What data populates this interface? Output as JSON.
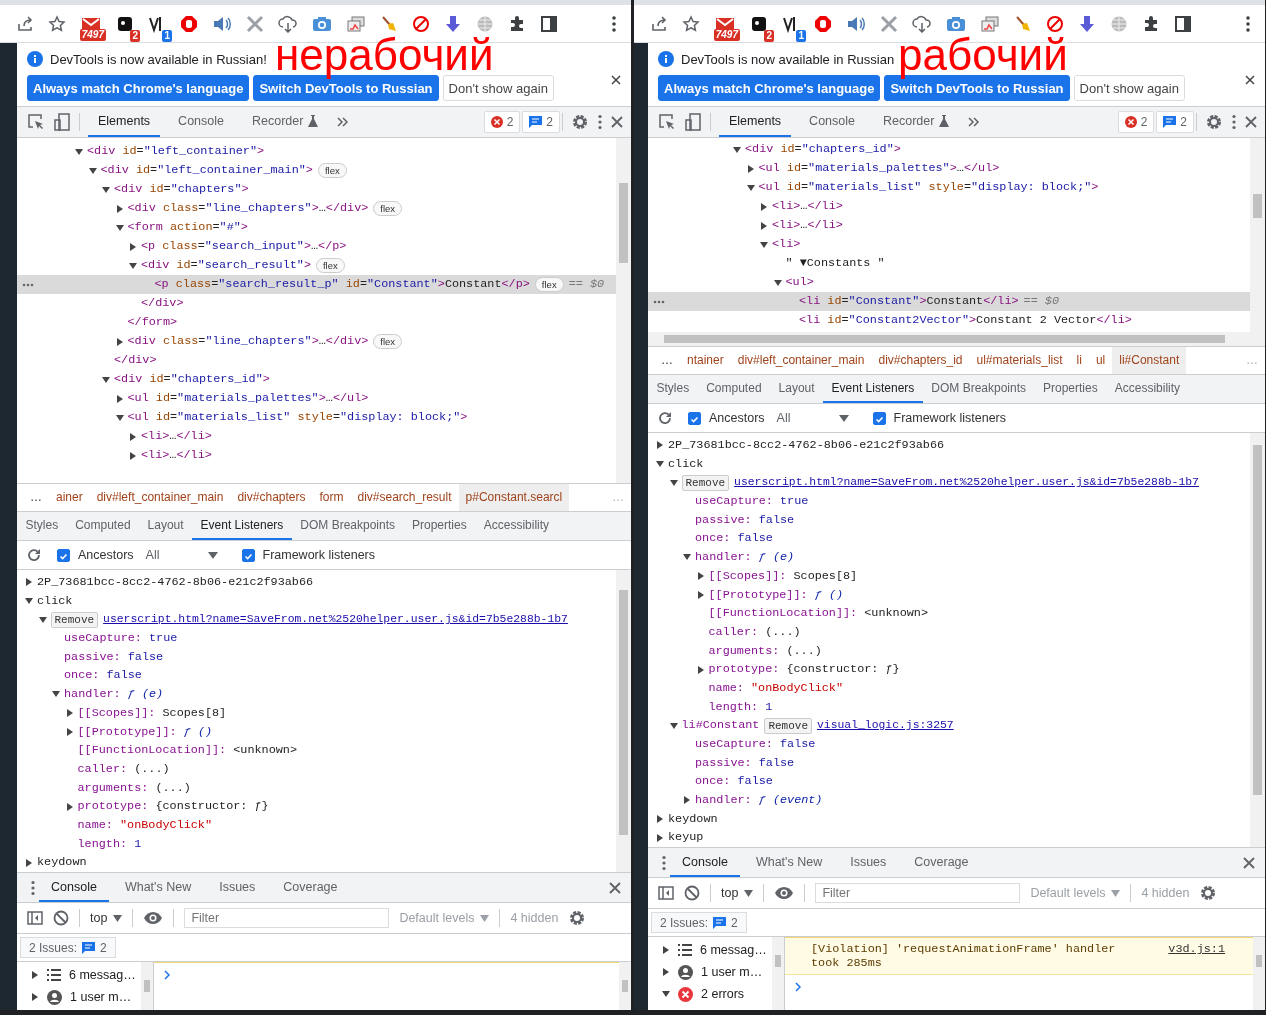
{
  "panels": [
    {
      "annotation": "нерабочий",
      "browser_icons": [
        {
          "kind": "share"
        },
        {
          "kind": "star"
        },
        {
          "kind": "mail",
          "badge": "7497"
        },
        {
          "kind": "square",
          "badge": "2"
        },
        {
          "kind": "vector",
          "badge": "1"
        },
        {
          "kind": "stop"
        },
        {
          "kind": "speaker"
        },
        {
          "kind": "crossed"
        },
        {
          "kind": "cloud"
        },
        {
          "kind": "camera"
        },
        {
          "kind": "windows"
        },
        {
          "kind": "broom"
        },
        {
          "kind": "blocked"
        },
        {
          "kind": "download"
        },
        {
          "kind": "globe"
        },
        {
          "kind": "puzzle"
        },
        {
          "kind": "sidebar"
        },
        {
          "kind": "kebab"
        }
      ],
      "infobar": {
        "message": "DevTools is now available in Russian!",
        "buttons": [
          {
            "label": "Always match Chrome's language",
            "kind": "primary"
          },
          {
            "label": "Switch DevTools to Russian",
            "kind": "primary"
          },
          {
            "label": "Don't show again",
            "kind": "secondary"
          }
        ]
      },
      "tabs": [
        {
          "label": "Elements",
          "selected": true,
          "experimental": false
        },
        {
          "label": "Console",
          "selected": false,
          "experimental": false
        },
        {
          "label": "Recorder",
          "selected": false,
          "experimental": true
        }
      ],
      "counters": {
        "errors": "2",
        "messages": "2"
      },
      "dom": [
        {
          "text": "<div id=\"left_container\">",
          "selected": false,
          "expanded": true,
          "children": [
            {
              "text": "<div id=\"left_container_main\">",
              "badge": "flex",
              "selected": false,
              "expanded": true,
              "children": [
                {
                  "text": "<div id=\"chapters\">",
                  "selected": false,
                  "expanded": true,
                  "close": "</div>",
                  "children": [
                    {
                      "text": "<div class=\"line_chapters\">…</div>",
                      "badge": "flex",
                      "selected": false,
                      "expanded": false
                    },
                    {
                      "text": "<form action=\"#\">",
                      "selected": false,
                      "expanded": true,
                      "close": "</form>",
                      "children": [
                        {
                          "text": "<p class=\"search_input\">…</p>",
                          "selected": false,
                          "expanded": false
                        },
                        {
                          "text": "<div id=\"search_result\">",
                          "badge": "flex",
                          "selected": false,
                          "expanded": true,
                          "close": "</div>",
                          "children": [
                            {
                              "text": "<p class=\"search_result_p\" id=\"Constant\">Constant</p>",
                              "badge": "flex",
                              "ref": "== $0",
                              "selected": true
                            }
                          ]
                        }
                      ]
                    },
                    {
                      "text": "<div class=\"line_chapters\">…</div>",
                      "badge": "flex",
                      "selected": false,
                      "expanded": false
                    }
                  ]
                },
                {
                  "text": "<div id=\"chapters_id\">",
                  "selected": false,
                  "expanded": true,
                  "children": [
                    {
                      "text": "<ul id=\"materials_palettes\">…</ul>",
                      "selected": false,
                      "expanded": false
                    },
                    {
                      "text": "<ul id=\"materials_list\" style=\"display: block;\">",
                      "selected": false,
                      "expanded": true,
                      "children": [
                        {
                          "text": "<li>…</li>",
                          "selected": false,
                          "expanded": false
                        },
                        {
                          "text": "<li>…</li>",
                          "selected": false,
                          "expanded": false
                        }
                      ]
                    }
                  ]
                }
              ]
            }
          ]
        }
      ],
      "breadcrumbs": {
        "overflow_left": "…",
        "items": [
          {
            "label": "ainer",
            "selected": false
          },
          {
            "label": "div#left_container_main",
            "selected": false
          },
          {
            "label": "div#chapters",
            "selected": false
          },
          {
            "label": "form",
            "selected": false
          },
          {
            "label": "div#search_result",
            "selected": false
          },
          {
            "label": "p#Constant.searcl",
            "selected": true
          }
        ],
        "overflow_right": "…"
      },
      "sidebar_tabs": [
        {
          "label": "Styles",
          "selected": false
        },
        {
          "label": "Computed",
          "selected": false
        },
        {
          "label": "Layout",
          "selected": false
        },
        {
          "label": "Event Listeners",
          "selected": true
        },
        {
          "label": "DOM Breakpoints",
          "selected": false
        },
        {
          "label": "Properties",
          "selected": false
        },
        {
          "label": "Accessibility",
          "selected": false
        }
      ],
      "listener_filter": {
        "ancestors": {
          "label": "Ancestors",
          "checked": true
        },
        "scope": "All",
        "framework": {
          "label": "Framework listeners",
          "checked": true
        }
      },
      "listeners": [
        {
          "kind": "event",
          "label": "2P_73681bcc-8cc2-4762-8b06-e21c2f93ab66",
          "expanded": false
        },
        {
          "kind": "event",
          "label": "click",
          "expanded": true,
          "children": [
            {
              "kind": "listener",
              "remove": "Remove",
              "source": "userscript.html?name=SaveFrom.net%2520helper.user.js&id=7b5e288b-1b7",
              "expanded": true,
              "children": [
                {
                  "kind": "keyword",
                  "key": "useCapture:",
                  "value": "true"
                },
                {
                  "kind": "keyword",
                  "key": "passive:",
                  "value": "false"
                },
                {
                  "kind": "keyword",
                  "key": "once:",
                  "value": "false"
                },
                {
                  "kind": "function",
                  "key": "handler:",
                  "value": "ƒ (e)",
                  "expanded": true,
                  "children": [
                    {
                      "kind": "object",
                      "key": "[[Scopes]]:",
                      "value": "Scopes[8]",
                      "expanded": false
                    },
                    {
                      "kind": "function",
                      "key": "[[Prototype]]:",
                      "value": "ƒ ()",
                      "expanded": false
                    },
                    {
                      "kind": "object",
                      "key": "[[FunctionLocation]]:",
                      "value": "<unknown>"
                    },
                    {
                      "kind": "object",
                      "key": "caller:",
                      "value": "(...)"
                    },
                    {
                      "kind": "object",
                      "key": "arguments:",
                      "value": "(...)"
                    },
                    {
                      "kind": "object",
                      "key": "prototype:",
                      "value": "{constructor: ƒ}",
                      "expanded": false
                    },
                    {
                      "kind": "string",
                      "key": "name:",
                      "value": "\"onBodyClick\""
                    },
                    {
                      "kind": "keyword",
                      "key": "length:",
                      "value": "1"
                    }
                  ]
                }
              ]
            }
          ]
        },
        {
          "kind": "event",
          "label": "keydown",
          "expanded": false
        }
      ],
      "drawer_tabs": [
        {
          "label": "Console",
          "selected": true
        },
        {
          "label": "What's New",
          "selected": false
        },
        {
          "label": "Issues",
          "selected": false
        },
        {
          "label": "Coverage",
          "selected": false
        }
      ],
      "console_toolbar": {
        "context": "top",
        "filter_placeholder": "Filter",
        "levels": "Default levels",
        "hidden": "4 hidden"
      },
      "issues": {
        "label": "2 Issues:",
        "count": "2"
      },
      "console_sidebar": [
        {
          "kind": "messages",
          "label": "6 messag…",
          "expanded": false
        },
        {
          "kind": "user",
          "label": "1 user m…",
          "expanded": false
        }
      ]
    },
    {
      "annotation": "рабочий",
      "browser_icons": [
        {
          "kind": "share"
        },
        {
          "kind": "star"
        },
        {
          "kind": "mail",
          "badge": "7497"
        },
        {
          "kind": "square",
          "badge": "2"
        },
        {
          "kind": "vector",
          "badge": "1"
        },
        {
          "kind": "stop"
        },
        {
          "kind": "speaker"
        },
        {
          "kind": "crossed"
        },
        {
          "kind": "cloud"
        },
        {
          "kind": "camera"
        },
        {
          "kind": "windows"
        },
        {
          "kind": "broom"
        },
        {
          "kind": "blocked"
        },
        {
          "kind": "download"
        },
        {
          "kind": "globe"
        },
        {
          "kind": "puzzle"
        },
        {
          "kind": "sidebar"
        },
        {
          "kind": "kebab"
        }
      ],
      "infobar": {
        "message": "DevTools is now available in Russian",
        "buttons": [
          {
            "label": "Always match Chrome's language",
            "kind": "primary"
          },
          {
            "label": "Switch DevTools to Russian",
            "kind": "primary"
          },
          {
            "label": "Don't show again",
            "kind": "secondary"
          }
        ]
      },
      "tabs": [
        {
          "label": "Elements",
          "selected": true,
          "experimental": false
        },
        {
          "label": "Console",
          "selected": false,
          "experimental": false
        },
        {
          "label": "Recorder",
          "selected": false,
          "experimental": true
        }
      ],
      "counters": {
        "errors": "2",
        "messages": "2"
      },
      "dom": [
        {
          "text": "<div id=\"chapters_id\">",
          "selected": false,
          "expanded": true,
          "children": [
            {
              "text": "<ul id=\"materials_palettes\">…</ul>",
              "selected": false,
              "expanded": false
            },
            {
              "text": "<ul id=\"materials_list\" style=\"display: block;\">",
              "selected": false,
              "expanded": true,
              "children": [
                {
                  "text": "<li>…</li>",
                  "selected": false,
                  "expanded": false
                },
                {
                  "text": "<li>…</li>",
                  "selected": false,
                  "expanded": false
                },
                {
                  "text": "<li>",
                  "selected": false,
                  "expanded": true,
                  "children": [
                    {
                      "text": "\" ▼Constants \"",
                      "selected": false
                    },
                    {
                      "text": "<ul>",
                      "selected": false,
                      "expanded": true,
                      "children": [
                        {
                          "text": "<li id=\"Constant\">Constant</li>",
                          "ref": "== $0",
                          "selected": true
                        },
                        {
                          "text": "<li id=\"Constant2Vector\">Constant 2 Vector</li>",
                          "selected": false
                        }
                      ]
                    }
                  ]
                }
              ]
            }
          ]
        }
      ],
      "breadcrumbs": {
        "overflow_left": "…",
        "items": [
          {
            "label": "ntainer",
            "selected": false
          },
          {
            "label": "div#left_container_main",
            "selected": false
          },
          {
            "label": "div#chapters_id",
            "selected": false
          },
          {
            "label": "ul#materials_list",
            "selected": false
          },
          {
            "label": "li",
            "selected": false
          },
          {
            "label": "ul",
            "selected": false
          },
          {
            "label": "li#Constant",
            "selected": true
          }
        ],
        "overflow_right": "…"
      },
      "sidebar_tabs": [
        {
          "label": "Styles",
          "selected": false
        },
        {
          "label": "Computed",
          "selected": false
        },
        {
          "label": "Layout",
          "selected": false
        },
        {
          "label": "Event Listeners",
          "selected": true
        },
        {
          "label": "DOM Breakpoints",
          "selected": false
        },
        {
          "label": "Properties",
          "selected": false
        },
        {
          "label": "Accessibility",
          "selected": false
        }
      ],
      "listener_filter": {
        "ancestors": {
          "label": "Ancestors",
          "checked": true
        },
        "scope": "All",
        "framework": {
          "label": "Framework listeners",
          "checked": true
        }
      },
      "listeners": [
        {
          "kind": "event",
          "label": "2P_73681bcc-8cc2-4762-8b06-e21c2f93ab66",
          "expanded": false
        },
        {
          "kind": "event",
          "label": "click",
          "expanded": true,
          "children": [
            {
              "kind": "listener",
              "remove": "Remove",
              "source": "userscript.html?name=SaveFrom.net%2520helper.user.js&id=7b5e288b-1b7",
              "expanded": true,
              "children": [
                {
                  "kind": "keyword",
                  "key": "useCapture:",
                  "value": "true"
                },
                {
                  "kind": "keyword",
                  "key": "passive:",
                  "value": "false"
                },
                {
                  "kind": "keyword",
                  "key": "once:",
                  "value": "false"
                },
                {
                  "kind": "function",
                  "key": "handler:",
                  "value": "ƒ (e)",
                  "expanded": true,
                  "children": [
                    {
                      "kind": "object",
                      "key": "[[Scopes]]:",
                      "value": "Scopes[8]",
                      "expanded": false
                    },
                    {
                      "kind": "function",
                      "key": "[[Prototype]]:",
                      "value": "ƒ ()",
                      "expanded": false
                    },
                    {
                      "kind": "object",
                      "key": "[[FunctionLocation]]:",
                      "value": "<unknown>"
                    },
                    {
                      "kind": "object",
                      "key": "caller:",
                      "value": "(...)"
                    },
                    {
                      "kind": "object",
                      "key": "arguments:",
                      "value": "(...)"
                    },
                    {
                      "kind": "object",
                      "key": "prototype:",
                      "value": "{constructor: ƒ}",
                      "expanded": false
                    },
                    {
                      "kind": "string",
                      "key": "name:",
                      "value": "\"onBodyClick\""
                    },
                    {
                      "kind": "keyword",
                      "key": "length:",
                      "value": "1"
                    }
                  ]
                }
              ]
            },
            {
              "kind": "listener",
              "node": "li#Constant",
              "remove": "Remove",
              "source": "visual_logic.js:3257",
              "expanded": true,
              "children": [
                {
                  "kind": "keyword",
                  "key": "useCapture:",
                  "value": "false"
                },
                {
                  "kind": "keyword",
                  "key": "passive:",
                  "value": "false"
                },
                {
                  "kind": "keyword",
                  "key": "once:",
                  "value": "false"
                },
                {
                  "kind": "function",
                  "key": "handler:",
                  "value": "ƒ (event)",
                  "expanded": false
                }
              ]
            }
          ]
        },
        {
          "kind": "event",
          "label": "keydown",
          "expanded": false
        },
        {
          "kind": "event",
          "label": "keyup",
          "expanded": false
        }
      ],
      "drawer_tabs": [
        {
          "label": "Console",
          "selected": true
        },
        {
          "label": "What's New",
          "selected": false
        },
        {
          "label": "Issues",
          "selected": false
        },
        {
          "label": "Coverage",
          "selected": false
        }
      ],
      "console_toolbar": {
        "context": "top",
        "filter_placeholder": "Filter",
        "levels": "Default levels",
        "hidden": "4 hidden"
      },
      "issues": {
        "label": "2 Issues:",
        "count": "2"
      },
      "console_sidebar": [
        {
          "kind": "messages",
          "label": "6 messag…",
          "expanded": false
        },
        {
          "kind": "user",
          "label": "1 user m…",
          "expanded": false
        },
        {
          "kind": "errors",
          "label": "2 errors",
          "expanded": true
        }
      ],
      "console_messages": [
        {
          "kind": "violation",
          "text": "[Violation] 'requestAnimationFrame' handler took 285ms",
          "source": "v3d.js:1"
        }
      ]
    }
  ]
}
